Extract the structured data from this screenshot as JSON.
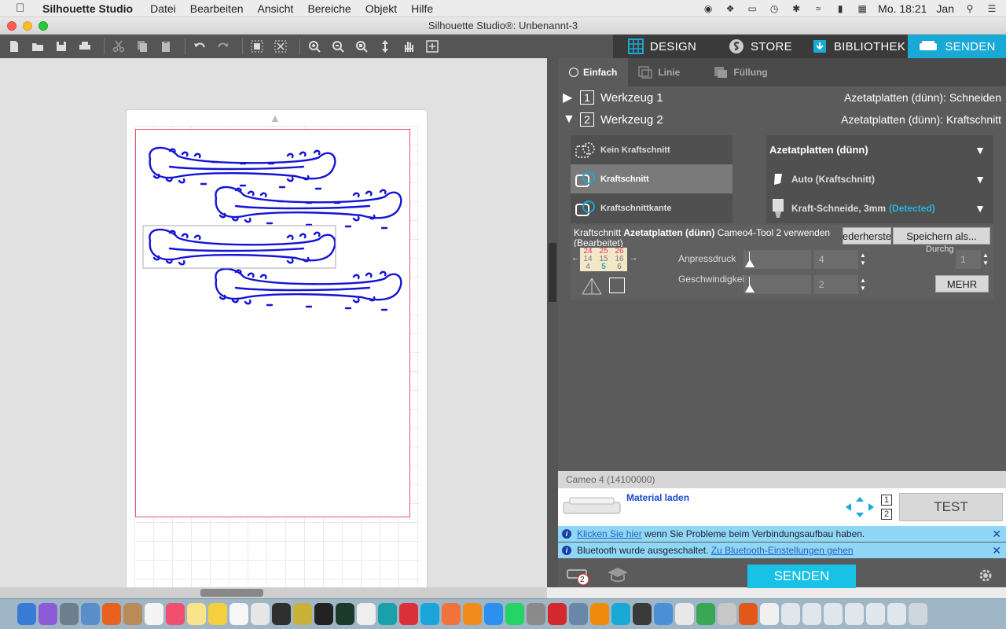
{
  "menubar": {
    "app": "Silhouette Studio",
    "items": [
      "Datei",
      "Bearbeiten",
      "Ansicht",
      "Bereiche",
      "Objekt",
      "Hilfe"
    ],
    "clock": "Mo. 18:21",
    "user": "Jan"
  },
  "window": {
    "title": "Silhouette Studio®: Unbenannt-3"
  },
  "tabs": {
    "design": "DESIGN",
    "store": "STORE",
    "library": "BIBLIOTHEK",
    "send": "SENDEN"
  },
  "subtabs": {
    "simple": "Einfach",
    "line": "Linie",
    "fill": "Füllung"
  },
  "tools": [
    {
      "num": "1",
      "label": "Werkzeug 1",
      "desc": "Azetatplatten (dünn): Schneiden"
    },
    {
      "num": "2",
      "label": "Werkzeug 2",
      "desc": "Azetatplatten (dünn): Kraftschnitt"
    }
  ],
  "cut_options": [
    "Kein Kraftschnitt",
    "Kraftschnitt",
    "Kraftschnittkante"
  ],
  "material": {
    "name": "Azetatplatten (dünn)",
    "action": "Auto (Kraftschnitt)",
    "blade": "Kraft-Schneide, 3mm",
    "blade_status": "(Detected)"
  },
  "settings": {
    "title_prefix": "Kraftschnitt ",
    "title_bold": "Azetatplatten (dünn)",
    "title_suffix": " Cameo4-Tool 2 verwenden (Bearbeitet)",
    "restore_label": "ederherste",
    "save_label": "Speichern als...",
    "grid": [
      "24",
      "25",
      "26",
      "14",
      "15",
      "16",
      "4",
      "5",
      "6"
    ],
    "pressure_label": "Anpressdruck",
    "pressure_value": "4",
    "speed_label": "Geschwindigkeit",
    "speed_value": "2",
    "passes_label": "Durchgänge",
    "passes_value": "1",
    "more_label": "MEHR"
  },
  "device": {
    "name": "Cameo 4 (14100000)",
    "load_label": "Material laden",
    "test_label": "TEST",
    "tool_nums": [
      "1",
      "2"
    ]
  },
  "notices": [
    {
      "link": "Klicken Sie hier",
      "text": " wenn Sie Probleme beim Verbindungsaufbau haben."
    },
    {
      "text": "Bluetooth wurde ausgeschaltet. ",
      "link": "Zu Bluetooth-Einstellungen gehen"
    }
  ],
  "bottom": {
    "send_label": "SENDEN",
    "badge": "2"
  },
  "colors": {
    "accent": "#18a9d6",
    "send": "#18c2e6",
    "design_stroke": "#1414d6",
    "page_border": "#e8556b"
  }
}
